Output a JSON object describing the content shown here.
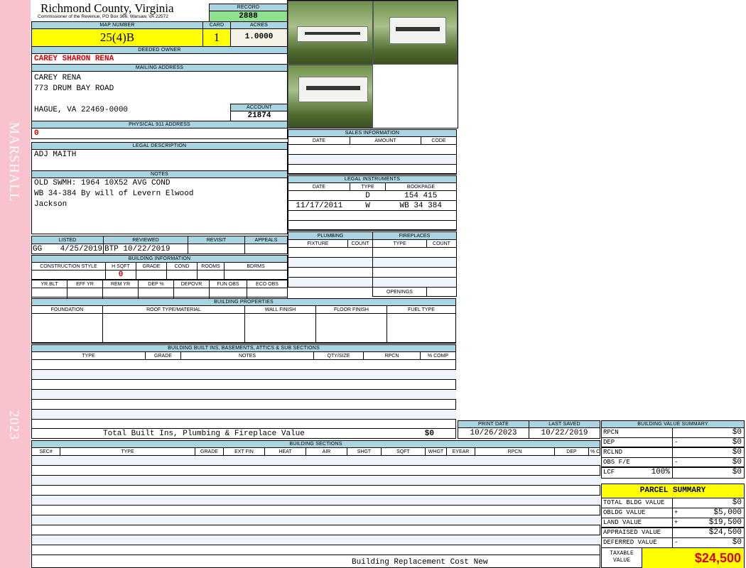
{
  "side": {
    "name": "MARSHALL",
    "year": "2023"
  },
  "header": {
    "title": "Richmond County, Virginia",
    "subtitle": "Commissioner of the Revenue, PO Box 366, Warsaw, VA 22572"
  },
  "record": {
    "label": "RECORD",
    "value": "2888"
  },
  "map": {
    "label": "MAP NUMBER",
    "value": "25(4)B",
    "card_label": "CARD",
    "card": "1",
    "acres_label": "ACRES",
    "acres": "1.0000"
  },
  "owner": {
    "label": "DEEDED OWNER",
    "value": "CAREY SHARON RENA"
  },
  "mailing": {
    "label": "MAILING ADDRESS",
    "line1": "CAREY RENA",
    "line2": "773 DRUM BAY ROAD",
    "line3": "HAGUE, VA 22469-0000"
  },
  "account": {
    "label": "ACCOUNT",
    "value": "21874"
  },
  "physical": {
    "label": "PHYSICAL 911 ADDRESS",
    "value": "0"
  },
  "legal": {
    "label": "LEGAL DESCRIPTION",
    "value": "ADJ MAITH"
  },
  "notes": {
    "label": "NOTES",
    "line1": "OLD SWMH: 1964 10X52 AVG COND",
    "line2": "WB 34-384 By will of Levern Elwood",
    "line3": "Jackson"
  },
  "listing": {
    "headers": [
      "LISTED",
      "REVIEWED",
      "REVISIT",
      "APPEALS"
    ],
    "listed_by": "GG",
    "listed_date": "4/25/2019",
    "reviewed_by": "BTP",
    "reviewed_date": "10/22/2019"
  },
  "building_info": {
    "label": "BUILDING INFORMATION",
    "headers1": [
      "CONSTRUCTION STYLE",
      "H SQFT",
      "GRADE",
      "COND",
      "ROOMS",
      "BDRMS"
    ],
    "hsqft": "0",
    "headers2": [
      "YR BLT",
      "EFF YR",
      "REM YR",
      "DEP %",
      "DEPOVR",
      "FUN OBS",
      "ECO OBS"
    ]
  },
  "sales": {
    "label": "SALES INFORMATION",
    "headers": [
      "DATE",
      "AMOUNT",
      "CODE"
    ]
  },
  "instruments": {
    "label": "LEGAL INSTRUMENTS",
    "headers": [
      "DATE",
      "TYPE",
      "BOOKPAGE"
    ],
    "rows": [
      {
        "date": "",
        "type": "D",
        "bookpage": "154 415"
      },
      {
        "date": "11/17/2011",
        "type": "W",
        "bookpage": "WB 34 384"
      }
    ]
  },
  "plumbing": {
    "label": "PLUMBING",
    "headers": [
      "FIXTURE",
      "COUNT"
    ]
  },
  "fireplaces": {
    "label": "FIREPLACES",
    "headers": [
      "TYPE",
      "COUNT"
    ],
    "openings": "OPENINGS"
  },
  "properties": {
    "label": "BUILDING PROPERTIES",
    "headers": [
      "FOUNDATION",
      "ROOF TYPE/MATERIAL",
      "WALL FINISH",
      "FLOOR FINISH",
      "FUEL TYPE"
    ]
  },
  "builtins": {
    "label": "BUILDING BUILT INS, BASEMENTS, ATTICS & SUB SECTIONS",
    "headers": [
      "TYPE",
      "GRADE",
      "NOTES",
      "QTY/SIZE",
      "RPCN",
      "% COMP"
    ],
    "total_label": "Total Built Ins, Plumbing & Fireplace Value",
    "total": "$0"
  },
  "dates": {
    "print_label": "PRINT DATE",
    "print": "10/26/2023",
    "saved_label": "LAST SAVED",
    "saved": "10/22/2019"
  },
  "sections": {
    "label": "BUILDING SECTIONS",
    "headers": [
      "SEC#",
      "TYPE",
      "GRADE",
      "EXT FIN",
      "HEAT",
      "AIR",
      "SHGT",
      "SQFT",
      "WHGT",
      "EYEAR",
      "RPCN",
      "DEP",
      "% COMP"
    ],
    "footer": "Building Replacement Cost New"
  },
  "value_summary": {
    "label": "BUILDING VALUE SUMMARY",
    "rows": [
      {
        "label": "RPCN",
        "sign": "",
        "value": "$0"
      },
      {
        "label": "DEP",
        "sign": "-",
        "value": "$0"
      },
      {
        "label": "RCLND",
        "sign": "",
        "value": "$0"
      },
      {
        "label": "OBS F/E",
        "sign": "-",
        "value": "$0"
      },
      {
        "label": "LCF",
        "pct": "100%",
        "sign": "",
        "value": "$0"
      }
    ]
  },
  "parcel": {
    "label": "PARCEL SUMMARY",
    "rows": [
      {
        "label": "TOTAL BLDG VALUE",
        "sign": "",
        "value": "$0"
      },
      {
        "label": "OBLDG VALUE",
        "sign": "+",
        "value": "$5,000"
      },
      {
        "label": "LAND VALUE",
        "sign": "+",
        "value": "$19,500"
      },
      {
        "label": "APPRAISED VALUE",
        "sign": "",
        "value": "$24,500"
      },
      {
        "label": "DEFERRED VALUE",
        "sign": "-",
        "value": "$0"
      }
    ],
    "taxable_label": "TAXABLE VALUE",
    "taxable": "$24,500"
  },
  "colors": {
    "header": "#a9d4e2",
    "yellow": "#ffff00",
    "green": "#8fe08f",
    "red": "#dd0000",
    "strip": "#f9c3cd"
  }
}
